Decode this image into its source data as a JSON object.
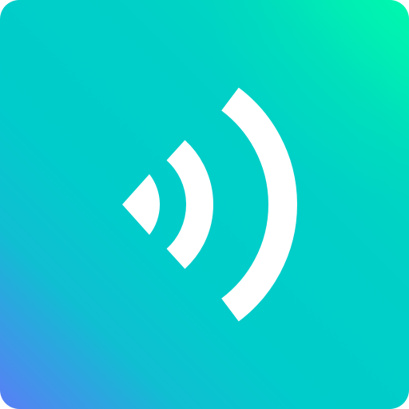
{
  "icon": {
    "name": "signal-broadcast-icon",
    "background_colors": [
      "#00f5b0",
      "#00cccb",
      "#5a7ef6"
    ],
    "glyph_color": "#ffffff"
  }
}
